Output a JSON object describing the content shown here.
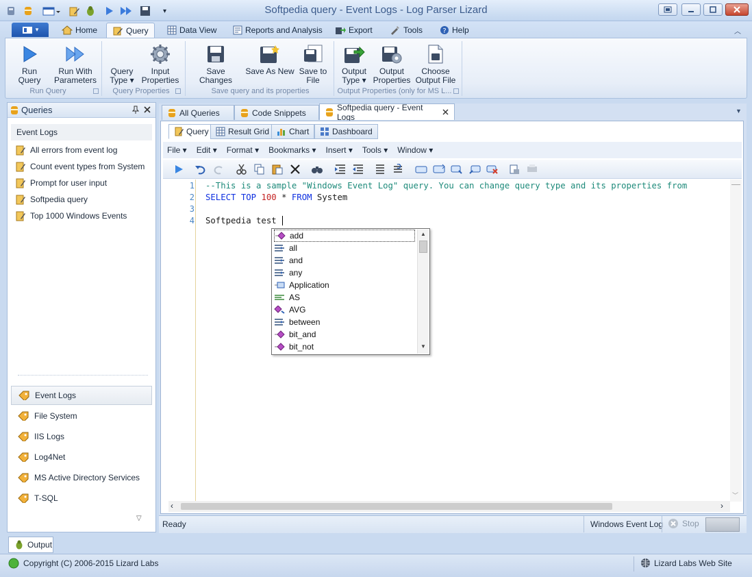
{
  "window": {
    "title": "Softpedia query - Event Logs - Log Parser Lizard"
  },
  "ribbon_tabs": [
    "Home",
    "Query",
    "Data View",
    "Reports and Analysis",
    "Export",
    "Tools",
    "Help"
  ],
  "ribbon": {
    "run_query": "Run Query",
    "run_with_parameters": [
      "Run With",
      "Parameters"
    ],
    "query_type": [
      "Query",
      "Type ▾"
    ],
    "input_properties": [
      "Input",
      "Properties"
    ],
    "save_changes": "Save Changes",
    "save_as_new": "Save As New",
    "save_to_file": [
      "Save to",
      "File"
    ],
    "output_type": [
      "Output",
      "Type ▾"
    ],
    "output_properties": [
      "Output",
      "Properties"
    ],
    "choose_output_file": [
      "Choose",
      "Output File"
    ],
    "groups": [
      "Run Query",
      "Query Properties",
      "Save query and its properties",
      "Output Properties (only for MS L..."
    ]
  },
  "left_panel": {
    "title": "Queries",
    "section": "Event Logs",
    "queries": [
      "All errors from event log",
      "Count event types from System",
      "Prompt for user input",
      "Softpedia query",
      "Top 1000 Windows Events"
    ],
    "nav": [
      "Event Logs",
      "File System",
      "IIS Logs",
      "Log4Net",
      "MS Active Directory Services",
      "T-SQL"
    ]
  },
  "doc_tabs": [
    "All Queries",
    "Code Snippets",
    "Softpedia query - Event Logs"
  ],
  "sub_tabs": [
    "Query",
    "Result Grid",
    "Chart",
    "Dashboard"
  ],
  "menu": [
    "File ▾",
    "Edit ▾",
    "Format ▾",
    "Bookmarks ▾",
    "Insert ▾",
    "Tools ▾",
    "Window ▾"
  ],
  "editor": {
    "line_numbers": [
      "1",
      "2",
      "3",
      "4"
    ],
    "line1": "--This is a sample \"Windows Event Log\" query. You can change query type and its properties from",
    "line2": {
      "kw1": "SELECT",
      "kw2": "TOP",
      "num": "100",
      "op": " * ",
      "kw3": "FROM",
      "tbl": " System"
    },
    "line4": "Softpedia test "
  },
  "autocomplete": [
    "add",
    "all",
    "and",
    "any",
    "Application",
    "AS",
    "AVG",
    "between",
    "bit_and",
    "bit_not"
  ],
  "status": {
    "ready": "Ready",
    "input_type": "Windows Event Log",
    "stop": "Stop"
  },
  "output_tab": "Output",
  "footer": {
    "copyright": "Copyright (C) 2006-2015 Lizard Labs",
    "website": "Lizard Labs Web Site"
  },
  "colors": {
    "accent": "#1f55ad",
    "comment": "#1d8a7a",
    "keyword": "#0d2fe0",
    "number": "#c42323"
  }
}
